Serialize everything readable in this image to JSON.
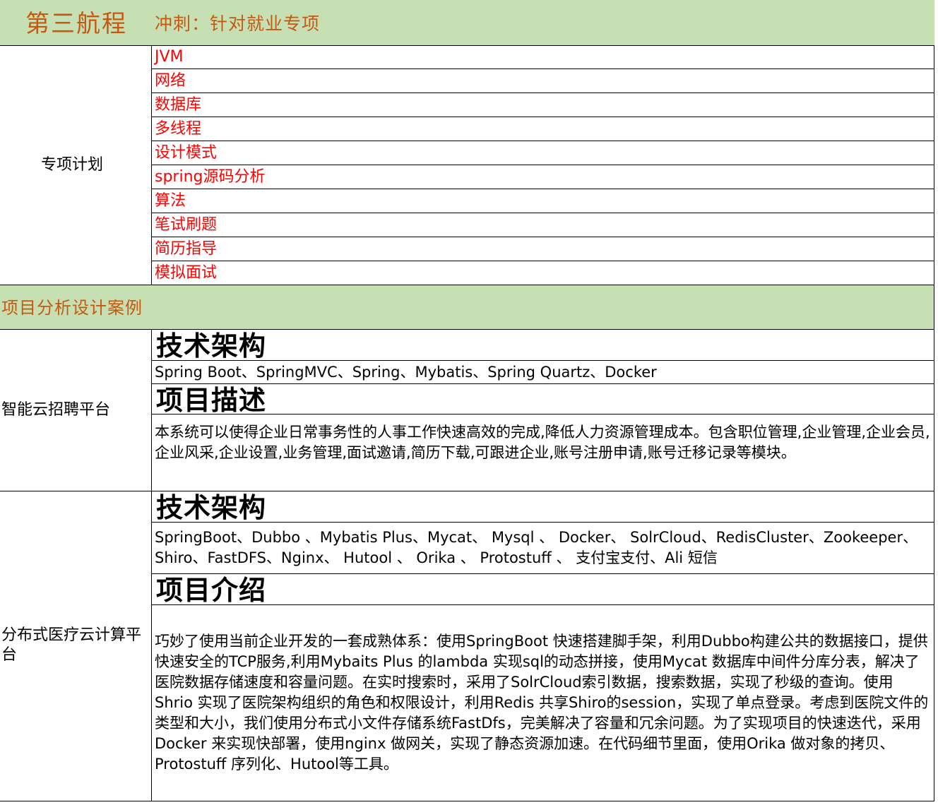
{
  "header": {
    "title": "第三航程",
    "subtitle": "冲刺：针对就业专项"
  },
  "plan": {
    "label": "专项计划",
    "items": [
      "JVM",
      "网络",
      "数据库",
      "多线程",
      "设计模式",
      "spring源码分析",
      "算法",
      "笔试刷题",
      "简历指导",
      "模拟面试"
    ]
  },
  "cases_header": "项目分析设计案例",
  "project1": {
    "name": "智能云招聘平台",
    "tech_heading": "技术架构",
    "tech": "Spring Boot、SpringMVC、Spring、Mybatis、Spring Quartz、Docker",
    "desc_heading": "项目描述",
    "desc": "本系统可以使得企业日常事务性的人事工作快速高效的完成,降低人力资源管理成本。包含职位管理,企业管理,企业会员, 企业风采,企业设置,业务管理,面试邀请,简历下载,可跟进企业,账号注册申请,账号迁移记录等模块。"
  },
  "project2": {
    "name": "分布式医疗云计算平台",
    "tech_heading": "技术架构",
    "tech": "SpringBoot、Dubbo 、Mybatis Plus、Mycat、 Mysql 、 Docker、 SolrCloud、RedisCluster、Zookeeper、Shiro、FastDFS、Nginx、 Hutool 、 Orika 、 Protostuff 、 支付宝支付、Ali 短信",
    "desc_heading": "项目介绍",
    "desc": "巧妙了使用当前企业开发的一套成熟体系：使用SpringBoot 快速搭建脚手架，利用Dubbo构建公共的数据接口，提供快速安全的TCP服务,利用Mybaits Plus 的lambda 实现sql的动态拼接，使用Mycat 数据库中间件分库分表，解决了医院数据存储速度和容量问题。在实时搜索时，采用了SolrCloud索引数据，搜索数据，实现了秒级的查询。使用Shrio 实现了医院架构组织的角色和权限设计，利用Redis 共享Shiro的session，实现了单点登录。考虑到医院文件的类型和大小，我们使用分布式小文件存储系统FastDfs，完美解决了容量和冗余问题。为了实现项目的快速迭代，采用Docker 来实现快部署，使用nginx 做网关，实现了静态资源加速。在代码细节里面，使用Orika 做对象的拷贝、Protostuff 序列化、Hutool等工具。"
  }
}
